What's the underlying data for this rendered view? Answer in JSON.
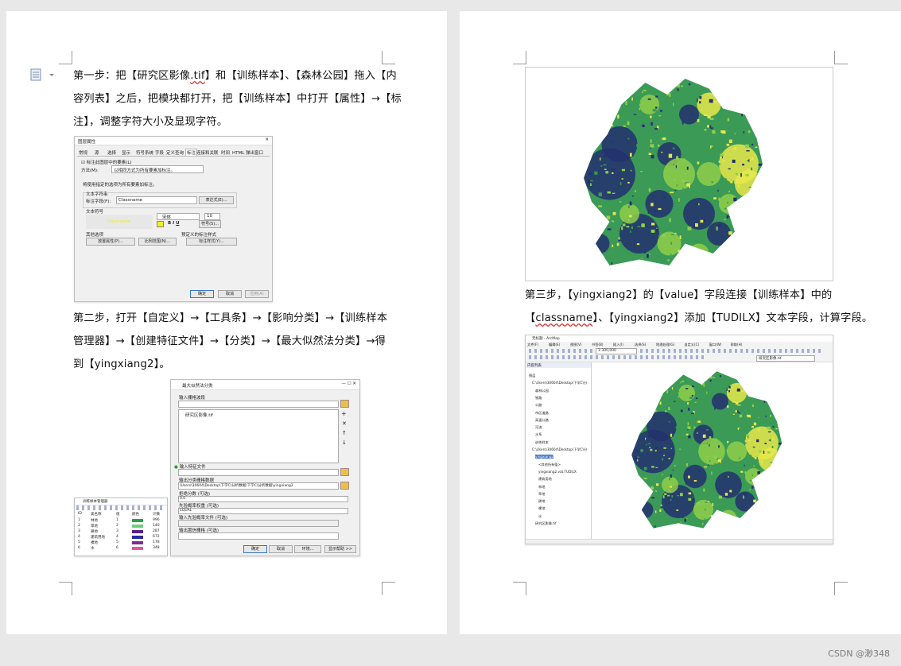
{
  "page_left": {
    "step1": {
      "lines": [
        "第一步：把【研究区影像",
        ".tif",
        "】和【训练样本】、【森林公园】拖入【内",
        "容列表】之后，把模块都打开，把【训练样本】中打开【属性】→【标",
        "注】，调整字符大小及显现字符。"
      ]
    },
    "label_dialog": {
      "title": "图层属性",
      "tabs": [
        "常规",
        "源",
        "选择",
        "显示",
        "符号系统",
        "字段",
        "定义查询",
        "标注",
        "连接和关联",
        "时间",
        "HTML 弹出窗口"
      ],
      "checkbox_label": "标注此图层中的要素(L)",
      "method_label": "方法(M):",
      "method_value": "以相同方式为所有要素加标注。",
      "info_text": "将使用指定的选项为所有要素加标注。",
      "text_string_label": "文本字符串",
      "label_field_label": "标注字段(F):",
      "label_field_value": "Classname",
      "expression_button": "表达式(E)...",
      "text_symbol_label": "文本符号",
      "font_value": "宋体",
      "size_value": "10",
      "symbol_button": "符号(S)...",
      "other_options_label": "其他选项",
      "placement_button": "放置属性(P)...",
      "scale_button": "比例范围(N)...",
      "predefined_label": "预定义的标注样式",
      "style_button": "标注样式(Y)...",
      "ok": "确定",
      "cancel": "取消",
      "apply": "应用(A)"
    },
    "step2": {
      "lines": [
        "第二步，打开【自定义】→【工具条】→【影响分类】→【训练样本",
        "管理器】→【创建特征文件】→【分类】→【最大似然法分类】→得",
        "到【yingxiang2】。"
      ]
    },
    "mlc_dialog": {
      "title": "最大似然法分类",
      "input_raster_label": "输入栅格波段",
      "input_item": "研究区影像.tif",
      "signature_label": "输入特征文件",
      "output_label": "输出分类栅格数据",
      "output_value": "\\Users\\30604\\Desktop\\下学C\\分析数据\\下学C\\分析数据\\yingxiang2",
      "reject_label": "拒绝分数 (可选)",
      "reject_value": "0.0",
      "apriori_label": "先验概率权重 (可选)",
      "apriori_value": "EQUAL",
      "apriori_file_label": "输入先验概率文件 (可选)",
      "confidence_label": "输出置信栅格 (可选)",
      "ok": "确定",
      "cancel": "取消",
      "env": "环境...",
      "help": "显示帮助 >>"
    },
    "sample_manager": {
      "title": "训练样本管理器",
      "headers": [
        "ID",
        "类名称",
        "值",
        "颜色",
        "计数"
      ],
      "rows": [
        {
          "id": "1",
          "name": "林地",
          "value": "1",
          "color": "#2e9e4a",
          "count": "996"
        },
        {
          "id": "2",
          "name": "草地",
          "value": "2",
          "color": "#6fcf7a",
          "count": "140"
        },
        {
          "id": "3",
          "name": "耕地",
          "value": "3",
          "color": "#5a1e8c",
          "count": "287"
        },
        {
          "id": "4",
          "name": "建筑用地",
          "value": "4",
          "color": "#2a2a9a",
          "count": "672"
        },
        {
          "id": "5",
          "name": "裸地",
          "value": "5",
          "color": "#7a2d92",
          "count": "178"
        },
        {
          "id": "6",
          "name": "水",
          "value": "6",
          "color": "#e0569a",
          "count": "348"
        }
      ]
    }
  },
  "page_right": {
    "step3": {
      "lines": [
        "第三步，【yingxiang2】的【value】字段连接【训练样本】中的",
        "【",
        "classname",
        "】、【yingxiang2】添加【TUDILX】文本字段，计算字段。"
      ]
    },
    "arcmap": {
      "title": "无标题 - ArcMap",
      "menu": [
        "文件(F)",
        "编辑(E)",
        "视图(V)",
        "书签(B)",
        "插入(I)",
        "选择(S)",
        "地理处理(G)",
        "自定义(C)",
        "窗口(W)",
        "帮助(H)"
      ],
      "scale": "1:300,000",
      "toc_title": "内容列表",
      "layers": [
        "图层",
        "C:\\Users\\30604\\Desktop\\下学C\\分",
        "森林公园",
        "铁路",
        "公路",
        "市区道路",
        "高速公路",
        "河流",
        "水系",
        "训练样本",
        "C:\\Users\\30604\\Desktop\\下学C\\分",
        "yingxiang2",
        "<其他所有值>",
        "yingxiang2.vat.TUDILX",
        "建筑用地",
        "林地",
        "草地",
        "耕地",
        "裸地",
        "水",
        "研究区影像.tif"
      ],
      "layer_dropdown": "研究区影像.tif"
    }
  },
  "colors": {
    "map_dark": "#25306f",
    "map_green": "#3a9a56",
    "map_light": "#8fcf4a",
    "map_yellow": "#e8e74a"
  },
  "watermark": "CSDN @渺348"
}
